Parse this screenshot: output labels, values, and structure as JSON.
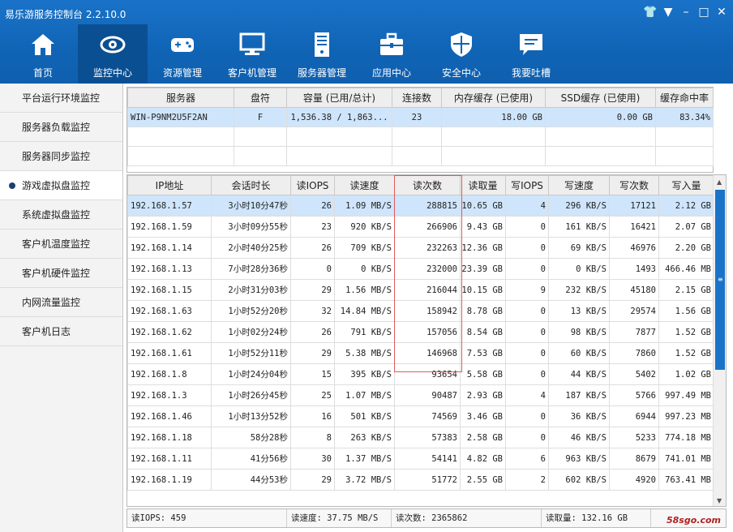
{
  "app": {
    "title": "易乐游服务控制台 2.2.10.0"
  },
  "window_controls": [
    {
      "name": "skin-icon",
      "glyph": "👕"
    },
    {
      "name": "menu-icon",
      "glyph": "▼"
    },
    {
      "name": "minimize-icon",
      "glyph": "–"
    },
    {
      "name": "maximize-icon",
      "glyph": "□"
    },
    {
      "name": "close-icon",
      "glyph": "✕"
    }
  ],
  "toolbar": [
    {
      "label": "首页",
      "icon": "home-icon"
    },
    {
      "label": "监控中心",
      "icon": "eye-icon",
      "active": true
    },
    {
      "label": "资源管理",
      "icon": "gamepad-icon"
    },
    {
      "label": "客户机管理",
      "icon": "monitor-icon"
    },
    {
      "label": "服务器管理",
      "icon": "server-icon"
    },
    {
      "label": "应用中心",
      "icon": "toolbox-icon"
    },
    {
      "label": "安全中心",
      "icon": "shield-icon"
    },
    {
      "label": "我要吐槽",
      "icon": "chat-icon"
    }
  ],
  "sidebar": [
    {
      "label": "平台运行环境监控"
    },
    {
      "label": "服务器负载监控"
    },
    {
      "label": "服务器同步监控"
    },
    {
      "label": "游戏虚拟盘监控",
      "active": true
    },
    {
      "label": "系统虚拟盘监控"
    },
    {
      "label": "客户机温度监控"
    },
    {
      "label": "客户机硬件监控"
    },
    {
      "label": "内网流量监控"
    },
    {
      "label": "客户机日志"
    }
  ],
  "server_table": {
    "columns": [
      "服务器",
      "盘符",
      "容量 (已用/总计)",
      "连接数",
      "内存缓存 (已使用)",
      "SSD缓存 (已使用)",
      "缓存命中率"
    ],
    "rows": [
      [
        "WIN-P9NM2U5F2AN",
        "F",
        "1,536.38 / 1,863...",
        "23",
        "18.00 GB",
        "0.00 GB",
        "83.34%"
      ]
    ]
  },
  "client_table": {
    "columns": [
      "IP地址",
      "会话时长",
      "读IOPS",
      "读速度",
      "读次数",
      "读取量",
      "写IOPS",
      "写速度",
      "写次数",
      "写入量"
    ],
    "rows": [
      [
        "192.168.1.57",
        "3小时10分47秒",
        "26",
        "1.09 MB/S",
        "288815",
        "10.65 GB",
        "4",
        "296 KB/S",
        "17121",
        "2.12 GB"
      ],
      [
        "192.168.1.59",
        "3小时09分55秒",
        "23",
        "920 KB/S",
        "266906",
        "9.43 GB",
        "0",
        "161 KB/S",
        "16421",
        "2.07 GB"
      ],
      [
        "192.168.1.14",
        "2小时40分25秒",
        "26",
        "709 KB/S",
        "232263",
        "12.36 GB",
        "0",
        "69 KB/S",
        "46976",
        "2.20 GB"
      ],
      [
        "192.168.1.13",
        "7小时28分36秒",
        "0",
        "0 KB/S",
        "232000",
        "23.39 GB",
        "0",
        "0 KB/S",
        "1493",
        "466.46 MB"
      ],
      [
        "192.168.1.15",
        "2小时31分03秒",
        "29",
        "1.56 MB/S",
        "216044",
        "10.15 GB",
        "9",
        "232 KB/S",
        "45180",
        "2.15 GB"
      ],
      [
        "192.168.1.63",
        "1小时52分20秒",
        "32",
        "14.84 MB/S",
        "158942",
        "8.78 GB",
        "0",
        "13 KB/S",
        "29574",
        "1.56 GB"
      ],
      [
        "192.168.1.62",
        "1小时02分24秒",
        "26",
        "791 KB/S",
        "157056",
        "8.54 GB",
        "0",
        "98 KB/S",
        "7877",
        "1.52 GB"
      ],
      [
        "192.168.1.61",
        "1小时52分11秒",
        "29",
        "5.38 MB/S",
        "146968",
        "7.53 GB",
        "0",
        "60 KB/S",
        "7860",
        "1.52 GB"
      ],
      [
        "192.168.1.8",
        "1小时24分04秒",
        "15",
        "395 KB/S",
        "93654",
        "5.58 GB",
        "0",
        "44 KB/S",
        "5402",
        "1.02 GB"
      ],
      [
        "192.168.1.3",
        "1小时26分45秒",
        "25",
        "1.07 MB/S",
        "90487",
        "2.93 GB",
        "4",
        "187 KB/S",
        "5766",
        "997.49 MB"
      ],
      [
        "192.168.1.46",
        "1小时13分52秒",
        "16",
        "501 KB/S",
        "74569",
        "3.46 GB",
        "0",
        "36 KB/S",
        "6944",
        "997.23 MB"
      ],
      [
        "192.168.1.18",
        "58分28秒",
        "8",
        "263 KB/S",
        "57383",
        "2.58 GB",
        "0",
        "46 KB/S",
        "5233",
        "774.18 MB"
      ],
      [
        "192.168.1.11",
        "41分56秒",
        "30",
        "1.37 MB/S",
        "54141",
        "4.82 GB",
        "6",
        "963 KB/S",
        "8679",
        "741.01 MB"
      ],
      [
        "192.168.1.19",
        "44分53秒",
        "29",
        "3.72 MB/S",
        "51772",
        "2.55 GB",
        "2",
        "602 KB/S",
        "4920",
        "763.41 MB"
      ]
    ]
  },
  "status_bar": {
    "read_iops": "读IOPS: 459",
    "read_speed": "读速度: 37.75 MB/S",
    "read_count": "读次数: 2365862",
    "read_amount": "读取量: 132.16 GB"
  },
  "watermark": "58sgo.com",
  "colors": {
    "titlebar": "#1a73c9",
    "toolbar_active": "#0b4f93",
    "selected_row": "#cfe5fb",
    "highlight_box": "#e05a5a"
  }
}
